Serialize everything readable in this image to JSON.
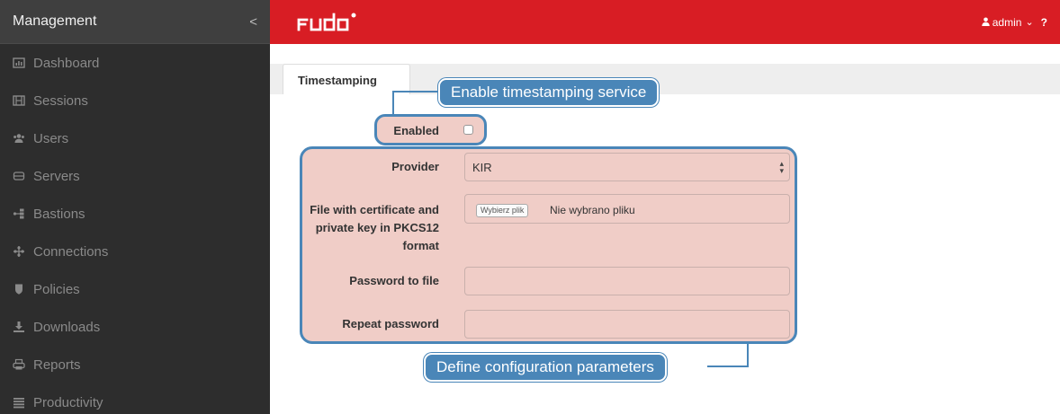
{
  "sidebar": {
    "title": "Management",
    "collapse_glyph": "<",
    "items": [
      {
        "label": "Dashboard",
        "icon": "dashboard-icon"
      },
      {
        "label": "Sessions",
        "icon": "film-icon"
      },
      {
        "label": "Users",
        "icon": "users-icon"
      },
      {
        "label": "Servers",
        "icon": "server-icon"
      },
      {
        "label": "Bastions",
        "icon": "bastion-icon"
      },
      {
        "label": "Connections",
        "icon": "connections-icon"
      },
      {
        "label": "Policies",
        "icon": "shield-icon"
      },
      {
        "label": "Downloads",
        "icon": "download-icon"
      },
      {
        "label": "Reports",
        "icon": "printer-icon"
      },
      {
        "label": "Productivity",
        "icon": "bars-icon"
      }
    ]
  },
  "topbar": {
    "user": "admin",
    "caret": "⌄",
    "help": "?",
    "brand_color": "#d81d24"
  },
  "tabs": [
    {
      "label": "Timestamping"
    }
  ],
  "form": {
    "enabled_label": "Enabled",
    "provider_label": "Provider",
    "provider_value": "KIR",
    "file_label": "File with certificate and private key in PKCS12 format",
    "file_button": "Wybierz plik",
    "file_status": "Nie wybrano pliku",
    "password_label": "Password to file",
    "repeat_password_label": "Repeat password"
  },
  "callouts": {
    "enable": "Enable timestamping service",
    "define": "Define configuration parameters"
  },
  "colors": {
    "highlight_fill": "#f0cdc7",
    "callout": "#4a86b8",
    "sidebar_bg": "#2d2d2d"
  }
}
